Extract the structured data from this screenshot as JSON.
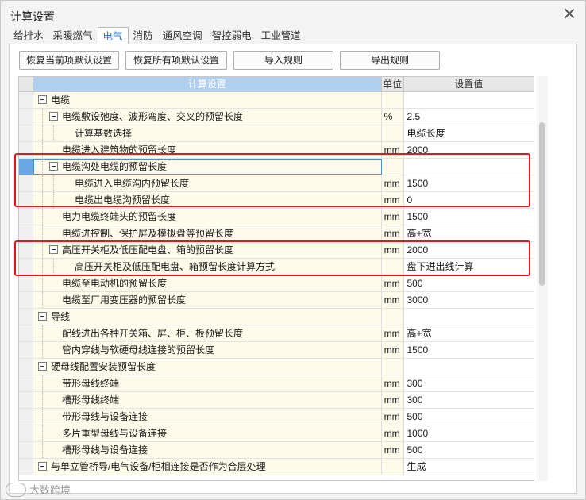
{
  "window": {
    "title": "计算设置"
  },
  "tabs": [
    {
      "label": "给排水"
    },
    {
      "label": "采暖燃气"
    },
    {
      "label": "电气"
    },
    {
      "label": "消防"
    },
    {
      "label": "通风空调"
    },
    {
      "label": "智控弱电"
    },
    {
      "label": "工业管道"
    }
  ],
  "toolbar": {
    "restore_current": "恢复当前项默认设置",
    "restore_all": "恢复所有项默认设置",
    "import_rules": "导入规则",
    "export_rules": "导出规则"
  },
  "table": {
    "headers": {
      "name": "计算设置",
      "unit": "单位",
      "value": "设置值"
    },
    "rows": [
      {
        "level": 0,
        "toggle": true,
        "name": "电缆",
        "unit": "",
        "value": ""
      },
      {
        "level": 1,
        "toggle": true,
        "name": "电缆敷设弛度、波形弯度、交叉的预留长度",
        "unit": "%",
        "value": "2.5"
      },
      {
        "level": 2,
        "toggle": false,
        "name": "计算基数选择",
        "unit": "",
        "value": "电缆长度"
      },
      {
        "level": 1,
        "toggle": false,
        "name": "电缆进入建筑物的预留长度",
        "unit": "mm",
        "value": "2000"
      },
      {
        "level": 1,
        "toggle": true,
        "name": "电缆沟处电缆的预留长度",
        "unit": "",
        "value": "",
        "selected": true
      },
      {
        "level": 2,
        "toggle": false,
        "name": "电缆进入电缆沟内预留长度",
        "unit": "mm",
        "value": "1500"
      },
      {
        "level": 2,
        "toggle": false,
        "name": "电缆出电缆沟预留长度",
        "unit": "mm",
        "value": "0"
      },
      {
        "level": 1,
        "toggle": false,
        "name": "电力电缆终端头的预留长度",
        "unit": "mm",
        "value": "1500"
      },
      {
        "level": 1,
        "toggle": false,
        "name": "电缆进控制、保护屏及模拟盘等预留长度",
        "unit": "mm",
        "value": "高+宽"
      },
      {
        "level": 1,
        "toggle": true,
        "name": "高压开关柜及低压配电盘、箱的预留长度",
        "unit": "mm",
        "value": "2000"
      },
      {
        "level": 2,
        "toggle": false,
        "name": "高压开关柜及低压配电盘、箱预留长度计算方式",
        "unit": "",
        "value": "盘下进出线计算"
      },
      {
        "level": 1,
        "toggle": false,
        "name": "电缆至电动机的预留长度",
        "unit": "mm",
        "value": "500"
      },
      {
        "level": 1,
        "toggle": false,
        "name": "电缆至厂用变压器的预留长度",
        "unit": "mm",
        "value": "3000"
      },
      {
        "level": 0,
        "toggle": true,
        "name": "导线",
        "unit": "",
        "value": ""
      },
      {
        "level": 1,
        "toggle": false,
        "name": "配线进出各种开关箱、屏、柜、板预留长度",
        "unit": "mm",
        "value": "高+宽"
      },
      {
        "level": 1,
        "toggle": false,
        "name": "管内穿线与软硬母线连接的预留长度",
        "unit": "mm",
        "value": "1500"
      },
      {
        "level": 0,
        "toggle": true,
        "name": "硬母线配置安装预留长度",
        "unit": "",
        "value": ""
      },
      {
        "level": 1,
        "toggle": false,
        "name": "带形母线终端",
        "unit": "mm",
        "value": "300"
      },
      {
        "level": 1,
        "toggle": false,
        "name": "槽形母线终端",
        "unit": "mm",
        "value": "300"
      },
      {
        "level": 1,
        "toggle": false,
        "name": "带形母线与设备连接",
        "unit": "mm",
        "value": "500"
      },
      {
        "level": 1,
        "toggle": false,
        "name": "多片重型母线与设备连接",
        "unit": "mm",
        "value": "1000"
      },
      {
        "level": 1,
        "toggle": false,
        "name": "槽形母线与设备连接",
        "unit": "mm",
        "value": "500"
      },
      {
        "level": 0,
        "toggle": true,
        "name": "与单立管桥导/电气设备/柜相连接是否作为合层处理",
        "unit": "",
        "value": "生成"
      }
    ]
  },
  "watermark": {
    "text": "大数跨境"
  },
  "colors": {
    "highlight": "#e0191d",
    "accent": "#1f6fd1",
    "name_cell_bg": "#fefbea"
  }
}
